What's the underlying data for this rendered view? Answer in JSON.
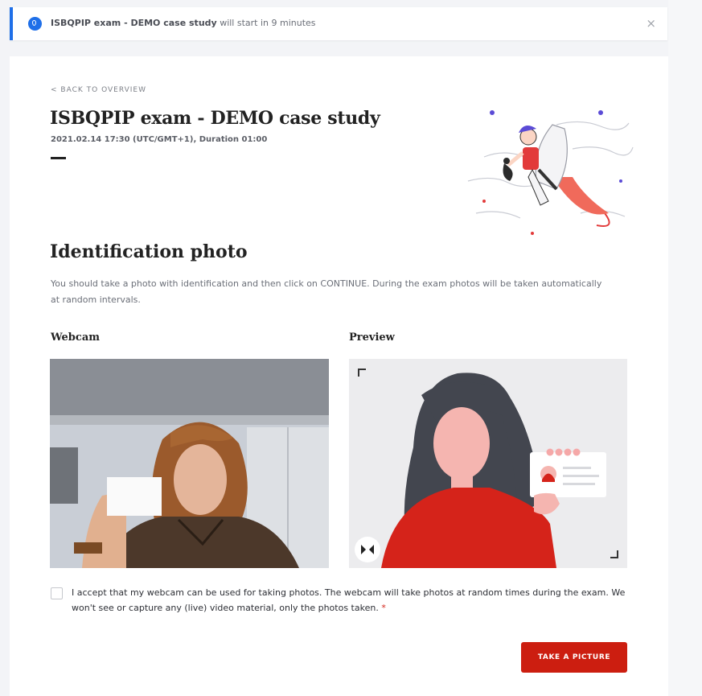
{
  "banner": {
    "exam_name": "ISBQPIP exam - DEMO case study",
    "message": " will start in 9 minutes",
    "close_label": "×"
  },
  "back_link": "< BACK TO OVERVIEW",
  "exam": {
    "title": "ISBQPIP exam - DEMO case study",
    "datetime": "2021.02.14 17:30 (UTC/GMT+1), Duration 01:00"
  },
  "identification": {
    "title": "Identification photo",
    "description": "You should take a photo with identification and then click on CONTINUE. During the exam photos will be taken automatically at random intervals."
  },
  "webcam": {
    "label": "Webcam"
  },
  "preview": {
    "label": "Preview"
  },
  "consent": {
    "text": "I accept that my webcam can be used for taking photos. The webcam will take photos at random times during the exam. We won't see or capture any (live) video material, only the photos taken.",
    "required_mark": "*"
  },
  "actions": {
    "take_picture": "TAKE A PICTURE"
  },
  "colors": {
    "accent": "#cc1e10",
    "info_blue": "#1f6fe8"
  }
}
